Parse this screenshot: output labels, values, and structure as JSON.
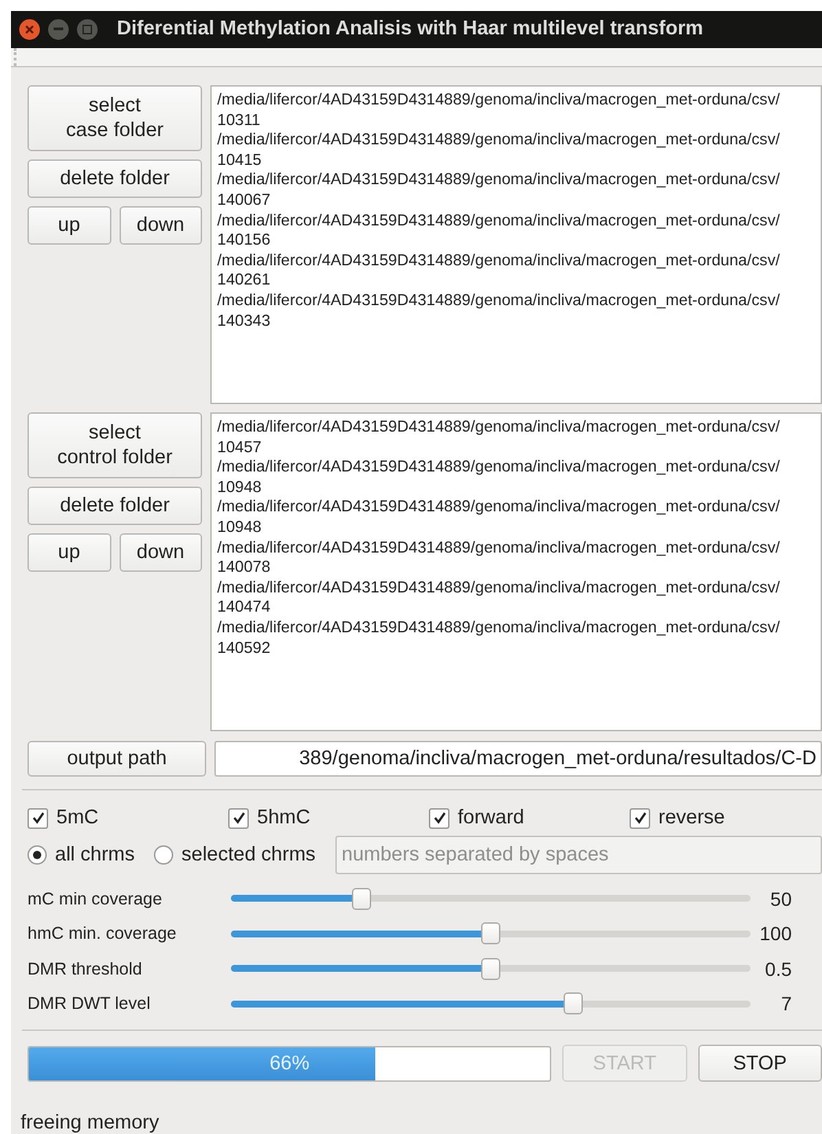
{
  "window": {
    "title": "Diferential Methylation Analisis with Haar multilevel transform"
  },
  "case": {
    "select_button": "select\ncase folder",
    "delete_button": "delete folder",
    "up_button": "up",
    "down_button": "down",
    "paths": [
      "/media/lifercor/4AD43159D4314889/genoma/incliva/macrogen_met-orduna/csv/10311",
      "/media/lifercor/4AD43159D4314889/genoma/incliva/macrogen_met-orduna/csv/10415",
      "/media/lifercor/4AD43159D4314889/genoma/incliva/macrogen_met-orduna/csv/140067",
      "/media/lifercor/4AD43159D4314889/genoma/incliva/macrogen_met-orduna/csv/140156",
      "/media/lifercor/4AD43159D4314889/genoma/incliva/macrogen_met-orduna/csv/140261",
      "/media/lifercor/4AD43159D4314889/genoma/incliva/macrogen_met-orduna/csv/140343"
    ]
  },
  "control": {
    "select_button": "select\ncontrol folder",
    "delete_button": "delete folder",
    "up_button": "up",
    "down_button": "down",
    "paths": [
      "/media/lifercor/4AD43159D4314889/genoma/incliva/macrogen_met-orduna/csv/10457",
      "/media/lifercor/4AD43159D4314889/genoma/incliva/macrogen_met-orduna/csv/10948",
      "/media/lifercor/4AD43159D4314889/genoma/incliva/macrogen_met-orduna/csv/10948",
      "/media/lifercor/4AD43159D4314889/genoma/incliva/macrogen_met-orduna/csv/140078",
      "/media/lifercor/4AD43159D4314889/genoma/incliva/macrogen_met-orduna/csv/140474",
      "/media/lifercor/4AD43159D4314889/genoma/incliva/macrogen_met-orduna/csv/140592"
    ]
  },
  "output": {
    "button": "output path",
    "value": "389/genoma/incliva/macrogen_met-orduna/resultados/C-D"
  },
  "checkboxes": [
    {
      "label": "5mC",
      "checked": true
    },
    {
      "label": "5hmC",
      "checked": true
    },
    {
      "label": "forward",
      "checked": true
    },
    {
      "label": "reverse",
      "checked": true
    }
  ],
  "chromosomes": {
    "options": [
      {
        "label": "all chrms",
        "selected": true
      },
      {
        "label": "selected chrms",
        "selected": false
      }
    ],
    "placeholder": "numbers separated by spaces",
    "disabled": true
  },
  "sliders": [
    {
      "label": "mC min coverage",
      "level": 0.25,
      "reading": "50"
    },
    {
      "label": "hmC min. coverage",
      "level": 0.5,
      "reading": "100"
    },
    {
      "label": "DMR threshold",
      "level": 0.5,
      "reading": "0.5"
    },
    {
      "label": "DMR DWT level",
      "level": 0.66,
      "reading": "7"
    }
  ],
  "progress": {
    "level": 0.665,
    "text": "66%"
  },
  "buttons": [
    {
      "label": "START",
      "disabled": true
    },
    {
      "label": "STOP",
      "disabled": false
    }
  ],
  "status": "freeing memory"
}
